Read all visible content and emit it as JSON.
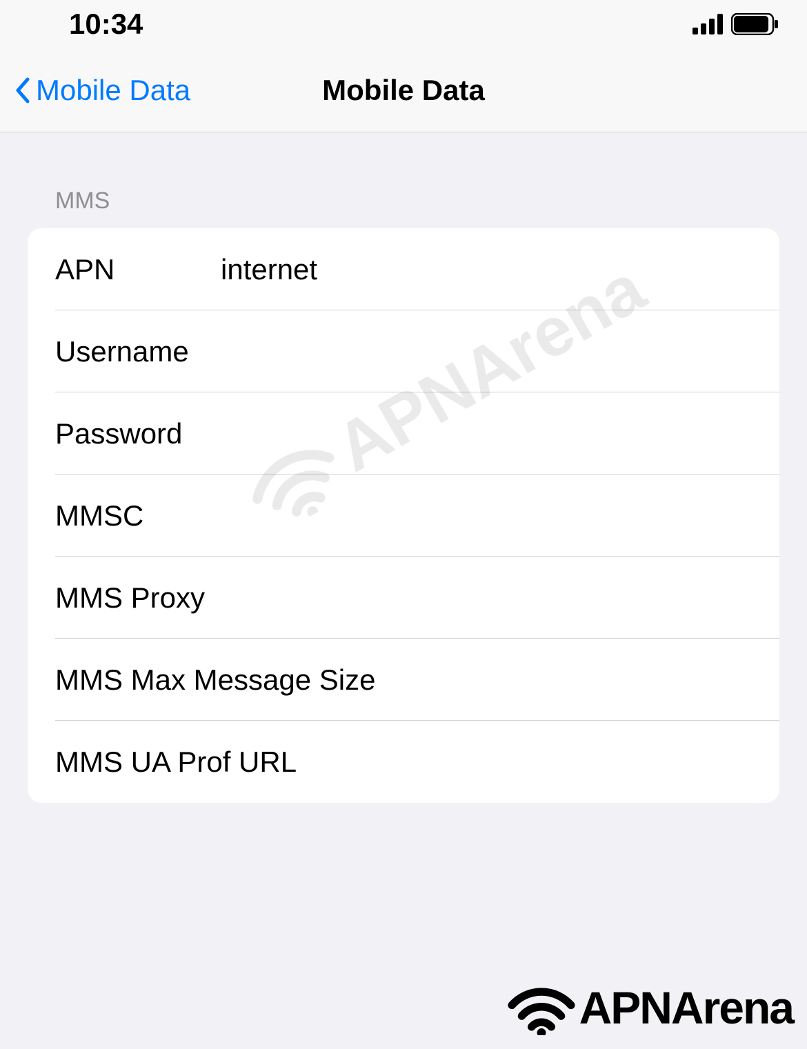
{
  "statusBar": {
    "time": "10:34"
  },
  "navBar": {
    "backLabel": "Mobile Data",
    "title": "Mobile Data"
  },
  "section": {
    "header": "MMS",
    "rows": {
      "apn": {
        "label": "APN",
        "value": "internet"
      },
      "username": {
        "label": "Username",
        "value": ""
      },
      "password": {
        "label": "Password",
        "value": ""
      },
      "mmsc": {
        "label": "MMSC",
        "value": ""
      },
      "mmsProxy": {
        "label": "MMS Proxy",
        "value": ""
      },
      "mmsMaxSize": {
        "label": "MMS Max Message Size",
        "value": ""
      },
      "mmsUaProf": {
        "label": "MMS UA Prof URL",
        "value": ""
      }
    }
  },
  "watermark": {
    "text": "APNArena"
  }
}
